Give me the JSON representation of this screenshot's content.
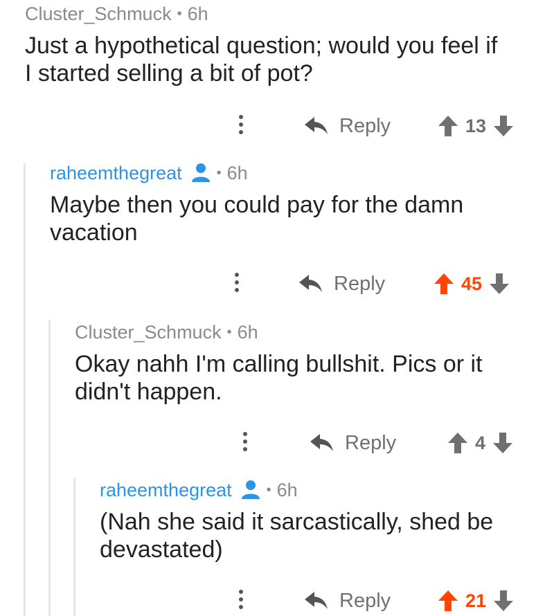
{
  "colors": {
    "upvoted": "#ff4500",
    "neutral": "#707070",
    "submitter_name": "#2a95e8",
    "author_name": "#8a8a8a",
    "thread_line": "#e6e6e6"
  },
  "comments": [
    {
      "author": "Cluster_Schmuck",
      "separator": "•",
      "time": "6h",
      "is_submitter": false,
      "text": "Just a hypothetical question; would you feel if I started selling a bit of pot?",
      "reply_label": "Reply",
      "score": "13",
      "upvoted": false
    },
    {
      "author": "raheemthegreat",
      "separator": "•",
      "time": "6h",
      "is_submitter": true,
      "text": "Maybe then you could pay for the damn vacation",
      "reply_label": "Reply",
      "score": "45",
      "upvoted": true
    },
    {
      "author": "Cluster_Schmuck",
      "separator": "•",
      "time": "6h",
      "is_submitter": false,
      "text": "Okay nahh I'm calling bullshit. Pics or it didn't happen.",
      "reply_label": "Reply",
      "score": "4",
      "upvoted": false
    },
    {
      "author": "raheemthegreat",
      "separator": "•",
      "time": "6h",
      "is_submitter": true,
      "text": "(Nah she said it sarcastically, shed be devastated)",
      "reply_label": "Reply",
      "score": "21",
      "upvoted": true
    }
  ]
}
